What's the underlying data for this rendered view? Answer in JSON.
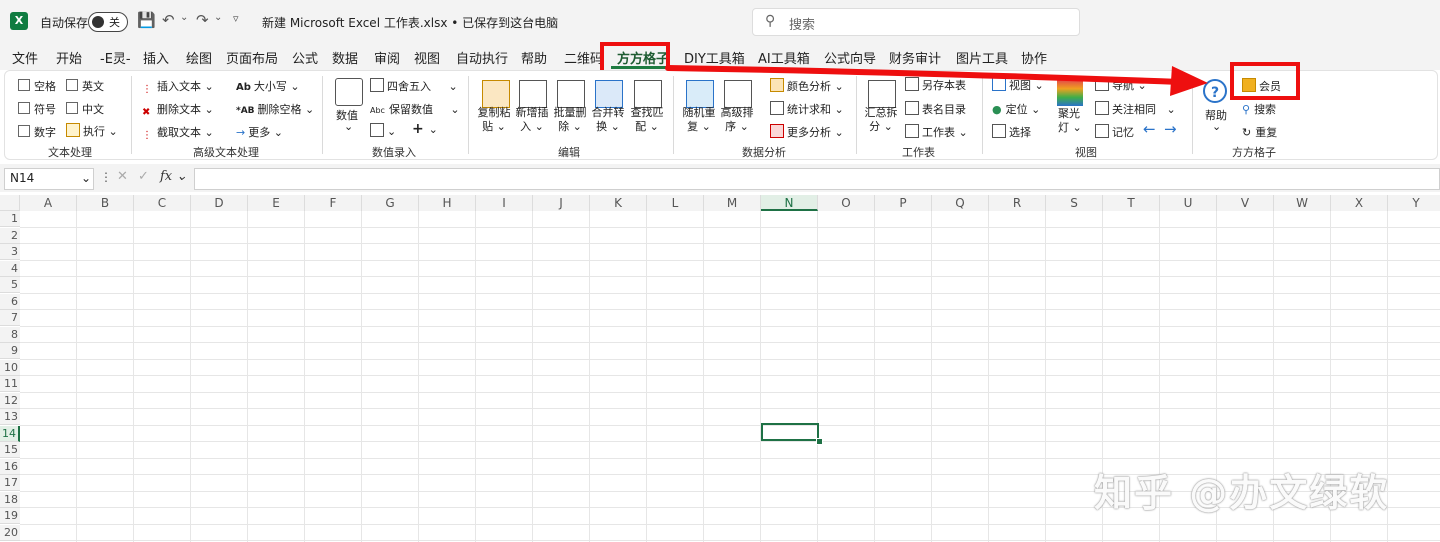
{
  "titlebar": {
    "autosave_label": "自动保存",
    "autosave_state": "关",
    "doc_title": "新建 Microsoft Excel 工作表.xlsx • 已保存到这台电脑",
    "search_placeholder": "搜索"
  },
  "menu": {
    "tabs": [
      "文件",
      "开始",
      "-E灵-",
      "插入",
      "绘图",
      "页面布局",
      "公式",
      "数据",
      "审阅",
      "视图",
      "自动执行",
      "帮助",
      "二维码",
      "方方格子",
      "DIY工具箱",
      "AI工具箱",
      "公式向导",
      "财务审计",
      "图片工具",
      "协作"
    ],
    "active_tab": "方方格子"
  },
  "ribbon": {
    "text_group": {
      "items": [
        "空格",
        "英文",
        "符号",
        "中文",
        "数字",
        "执行"
      ],
      "label": "文本处理"
    },
    "advanced_text": {
      "items": [
        "插入文本",
        "删除文本",
        "截取文本",
        "大小写",
        "删除空格",
        "更多"
      ],
      "label": "高级文本处理"
    },
    "number_entry": {
      "big": "数值",
      "items": [
        "四舍五入",
        "保留数值"
      ],
      "label": "数值录入"
    },
    "edit": {
      "buttons": [
        "复制粘贴",
        "新增插入",
        "批量删除",
        "合并转换",
        "查找匹配"
      ],
      "label": "编辑"
    },
    "analysis": {
      "buttons": [
        "随机重复",
        "高级排序"
      ],
      "items": [
        "颜色分析",
        "统计求和",
        "更多分析"
      ],
      "label": "数据分析"
    },
    "sheet": {
      "buttons": [
        "汇总拆分"
      ],
      "items": [
        "另存本表",
        "表名目录",
        "工作表"
      ],
      "label": "工作表"
    },
    "view": {
      "items": [
        "视图",
        "定位",
        "选择",
        "导航",
        "关注相同",
        "记忆"
      ],
      "spotlight": "聚光灯",
      "label": "视图"
    },
    "fangfang": {
      "help": "帮助",
      "items": [
        "会员",
        "搜索",
        "重复"
      ],
      "label": "方方格子"
    }
  },
  "formula_bar": {
    "name_box": "N14",
    "fx": "fx",
    "value": ""
  },
  "sheet": {
    "columns": [
      "A",
      "B",
      "C",
      "D",
      "E",
      "F",
      "G",
      "H",
      "I",
      "J",
      "K",
      "L",
      "M",
      "N",
      "O",
      "P",
      "Q",
      "R",
      "S",
      "T",
      "U",
      "V",
      "W",
      "X",
      "Y"
    ],
    "rows": [
      "1",
      "2",
      "3",
      "4",
      "5",
      "6",
      "7",
      "8",
      "9",
      "10",
      "11",
      "12",
      "13",
      "14",
      "15",
      "16",
      "17",
      "18",
      "19",
      "20"
    ],
    "selected_cell": "N14"
  },
  "watermark": "知乎 @办文绿软",
  "colors": {
    "excel_green": "#107c41",
    "highlight_red": "#ee0f0f",
    "selection": "#1e7145"
  }
}
